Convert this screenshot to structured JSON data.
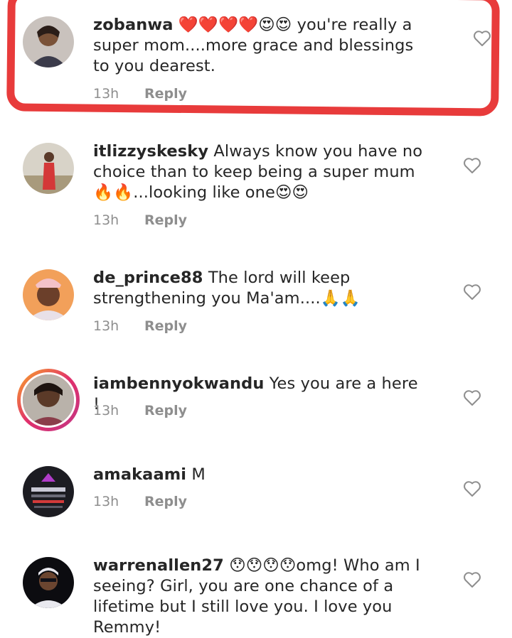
{
  "comments": [
    {
      "username": "zobanwa",
      "text": " ❤️❤️❤️❤️😍😍 you're really a super mom....more grace and blessings to you dearest.",
      "time": "13h",
      "reply_label": "Reply"
    },
    {
      "username": "itlizzyskesky",
      "text": " Always know you have no choice than to keep being a super mum🔥🔥...looking like one😍😍",
      "time": "13h",
      "reply_label": "Reply"
    },
    {
      "username": "de_prince88",
      "text": " The lord will keep strengthening you Ma'am....🙏🙏",
      "time": "13h",
      "reply_label": "Reply"
    },
    {
      "username": "iambennyokwandu",
      "text": " Yes you are a here !",
      "time": "13h",
      "reply_label": "Reply"
    },
    {
      "username": "amakaami",
      "text": " M",
      "time": "13h",
      "reply_label": "Reply"
    },
    {
      "username": "warrenallen27",
      "text": " 😯😯😯😯omg! Who am I seeing? Girl, you are one chance of a lifetime but I still love you. I love you Remmy!",
      "time": "",
      "reply_label": ""
    }
  ],
  "colors": {
    "highlight": "#e83b3b",
    "meta_text": "#8e8e8e",
    "primary_text": "#262626"
  },
  "icons": {
    "like": "heart-outline-icon"
  }
}
